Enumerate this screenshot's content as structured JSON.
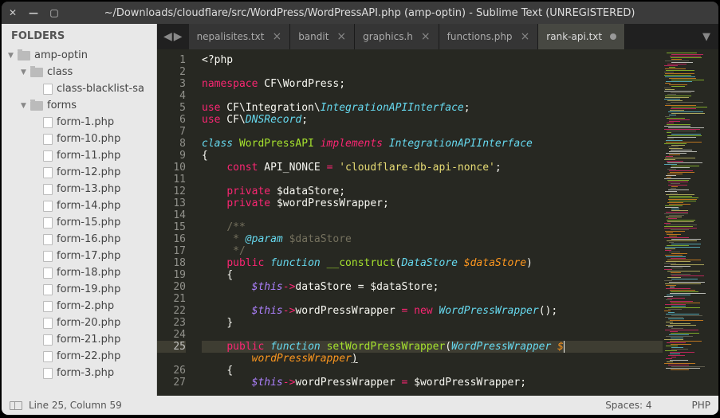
{
  "titlebar": {
    "title": "~/Downloads/cloudflare/src/WordPress/WordPressAPI.php (amp-optin) - Sublime Text (UNREGISTERED)"
  },
  "sidebar": {
    "header": "FOLDERS",
    "root": "amp-optin",
    "folders": [
      {
        "name": "class",
        "indent": 1,
        "open": true
      },
      {
        "name": "forms",
        "indent": 1,
        "open": true
      }
    ],
    "class_files": [
      "class-blacklist-sa"
    ],
    "form_files": [
      "form-1.php",
      "form-10.php",
      "form-11.php",
      "form-12.php",
      "form-13.php",
      "form-14.php",
      "form-15.php",
      "form-16.php",
      "form-17.php",
      "form-18.php",
      "form-19.php",
      "form-2.php",
      "form-20.php",
      "form-21.php",
      "form-22.php",
      "form-3.php"
    ]
  },
  "tabs": [
    {
      "label": "nepalisites.txt",
      "active": false,
      "dirty": false
    },
    {
      "label": "bandit",
      "active": false,
      "dirty": false
    },
    {
      "label": "graphics.h",
      "active": false,
      "dirty": false
    },
    {
      "label": "functions.php",
      "active": false,
      "dirty": false
    },
    {
      "label": "rank-api.txt",
      "active": true,
      "dirty": true
    }
  ],
  "code": {
    "lines": [
      1,
      2,
      3,
      4,
      5,
      6,
      7,
      8,
      9,
      10,
      11,
      12,
      13,
      14,
      15,
      16,
      17,
      18,
      19,
      20,
      21,
      22,
      23,
      24,
      25,
      "",
      26,
      27
    ],
    "highlight": 25,
    "t": {
      "php": "<?php",
      "namespace": "namespace",
      "ns": " CF\\WordPress;",
      "use": "use",
      "use1a": " CF\\Integration\\",
      "use1b": "IntegrationAPIInterface",
      "use2a": " CF\\",
      "use2b": "DNSRecord",
      "class": "class",
      "classname": "WordPressAPI",
      "implements": "implements",
      "iface": "IntegrationAPIInterface",
      "const": "const",
      "constname": "API_NONCE",
      "constval": "'cloudflare-db-api-nonce'",
      "private": "private",
      "ds": "$dataStore",
      "wpw": "$wordPressWrapper",
      "c1": "/**",
      "c2": " * ",
      "param": "@param",
      "c2b": " $dataStore",
      "c3": " */",
      "public": "public",
      "function": "function",
      "construct": "__construct",
      "DataStore": "DataStore",
      "this": "$this",
      "arrow": "->",
      "dataStore": "dataStore",
      "eq": " = ",
      "new": "new",
      "WPW": "WordPressWrapper",
      "wordPressWrapper": "wordPressWrapper",
      "setWPW": "setWordPressWrapper",
      "wpwParam": "$wordPressWrapper",
      "wpwParam2": "wordPressWrapper"
    }
  },
  "statusbar": {
    "position": "Line 25, Column 59",
    "spaces": "Spaces: 4",
    "syntax": "PHP"
  }
}
